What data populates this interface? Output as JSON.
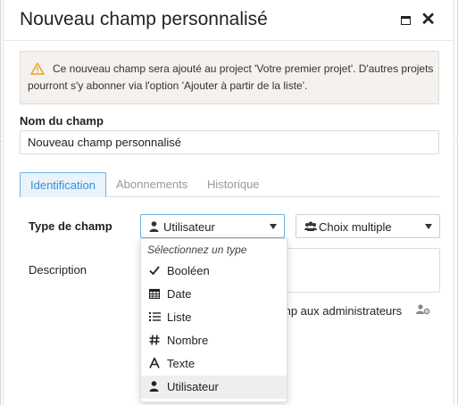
{
  "dialog": {
    "title": "Nouveau champ personnalisé"
  },
  "warning": {
    "text": "Ce nouveau champ sera ajouté au project 'Votre premier projet'. D'autres projets pourront s'y abonner via l'option 'Ajouter à partir de la liste'."
  },
  "field_name": {
    "label": "Nom du champ",
    "value": "Nouveau champ personnalisé"
  },
  "tabs": [
    {
      "label": "Identification",
      "active": true
    },
    {
      "label": "Abonnements",
      "active": false
    },
    {
      "label": "Historique",
      "active": false
    }
  ],
  "field_type": {
    "label": "Type de champ",
    "selected": "Utilisateur",
    "selected_icon": "user-icon"
  },
  "selection_mode": {
    "selected": "Choix multiple",
    "icon": "users-icon"
  },
  "description": {
    "label": "Description",
    "value": ""
  },
  "admin_option": {
    "text": "mp aux administrateurs",
    "icon": "user-cog-icon"
  },
  "dropdown": {
    "header": "Sélectionnez un type",
    "items": [
      {
        "label": "Booléen",
        "icon": "check-icon"
      },
      {
        "label": "Date",
        "icon": "calendar-icon"
      },
      {
        "label": "Liste",
        "icon": "list-icon"
      },
      {
        "label": "Nombre",
        "icon": "hash-icon"
      },
      {
        "label": "Texte",
        "icon": "text-icon"
      },
      {
        "label": "Utilisateur",
        "icon": "user-icon",
        "selected": true
      }
    ]
  },
  "colors": {
    "accent": "#3a8ed0",
    "warning_icon": "#e8a12c",
    "warning_bg": "#f4f1ef"
  }
}
